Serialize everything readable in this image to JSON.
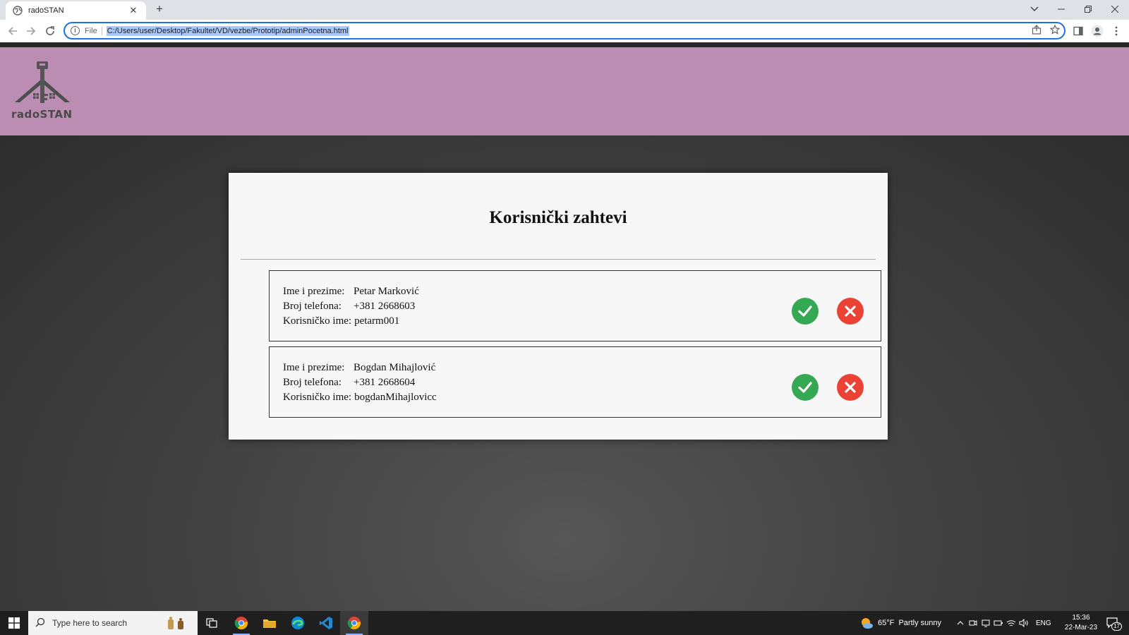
{
  "browser": {
    "tab_title": "radoSTAN",
    "tab_close": "✕",
    "new_tab": "+",
    "scheme_label": "File",
    "url": "C:/Users/user/Desktop/Fakultet/VD/vezbe/Prototip/adminPocetna.html"
  },
  "site": {
    "logo_text": "radoSTAN"
  },
  "card": {
    "title": "Korisnički zahtevi",
    "labels": {
      "name": "Ime i prezime:",
      "phone": "Broj telefona:",
      "username": "Korisničko ime:"
    },
    "requests": [
      {
        "name": "Petar Marković",
        "phone": "+381 2668603",
        "username": "petarm001"
      },
      {
        "name": "Bogdan Mihajlović",
        "phone": "+381 2668604",
        "username": "bogdanMihajlovicc"
      }
    ]
  },
  "taskbar": {
    "search_placeholder": "Type here to search",
    "weather": "65°F  Partly sunny",
    "language": "ENG",
    "time": "15:36",
    "date": "22-Mar-23",
    "notification_count": "17"
  },
  "colors": {
    "header": "#bb8db2",
    "accept": "#34a853",
    "reject": "#ea4335",
    "omnibox_focus": "#1a73e8"
  }
}
